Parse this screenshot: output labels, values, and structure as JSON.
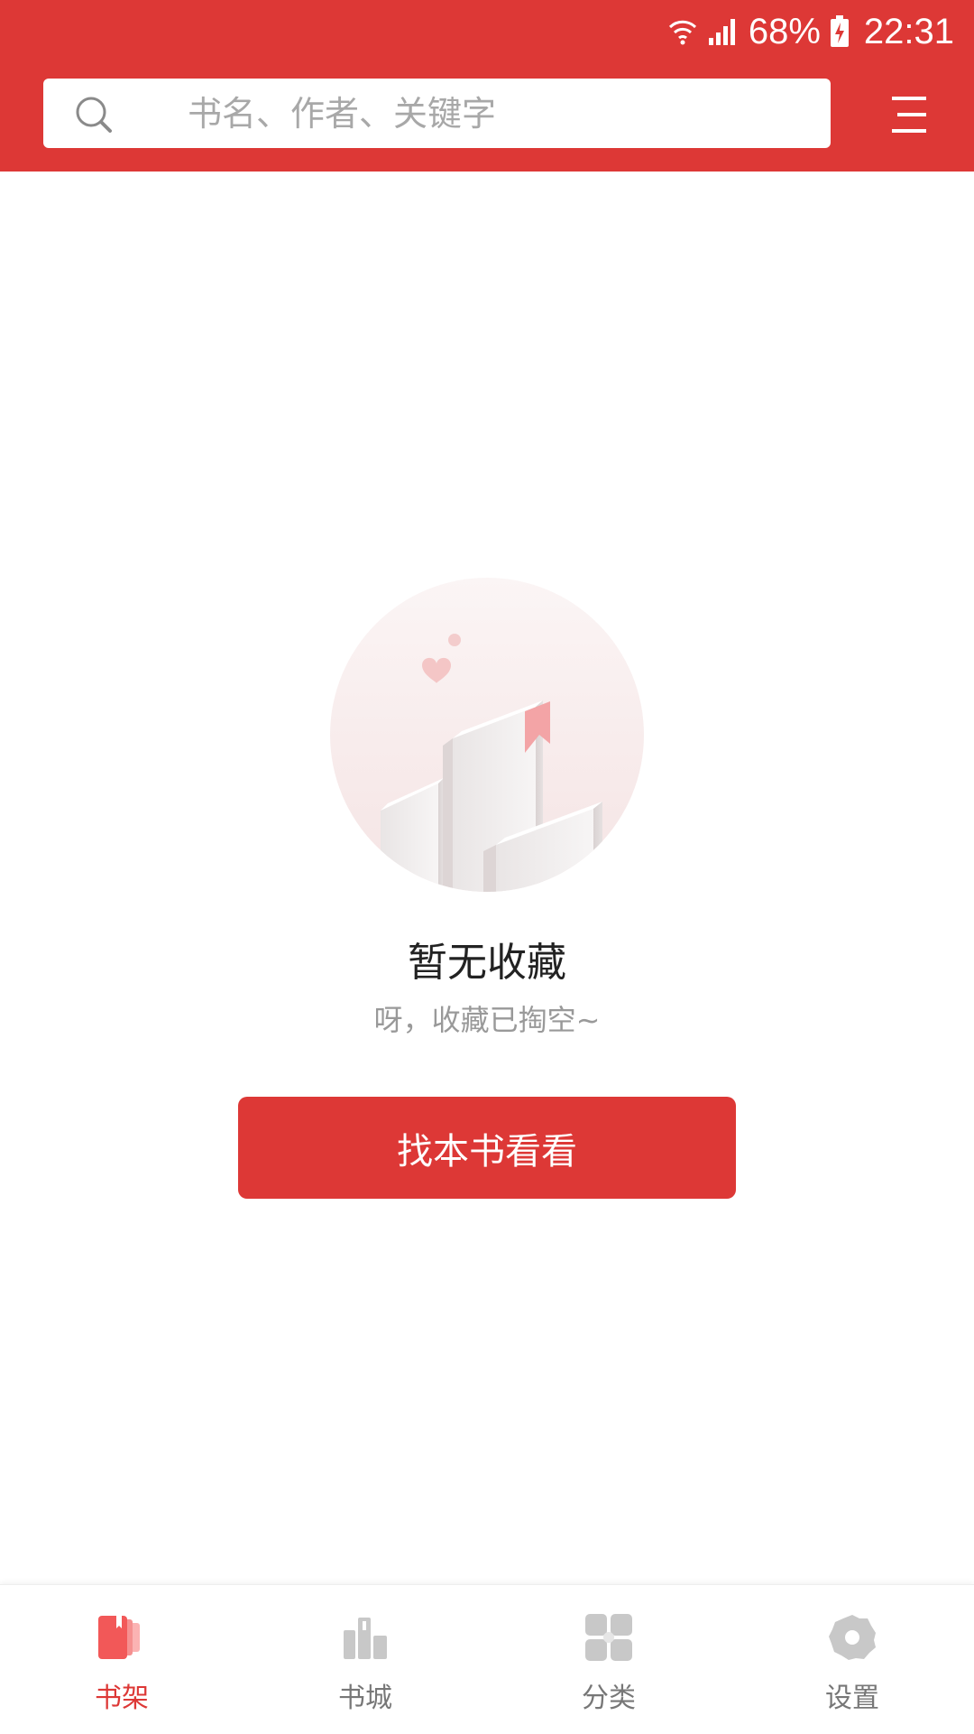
{
  "status_bar": {
    "wifi_icon": "wifi-icon",
    "signal_icon": "signal-icon",
    "battery_icon": "battery-charging-icon",
    "battery": "68%",
    "time": "22:31"
  },
  "header": {
    "search_placeholder": "书名、作者、关键字",
    "search_icon": "search-icon",
    "menu_icon": "menu-icon"
  },
  "empty_state": {
    "illustration": "empty-bookshelf-illustration",
    "title": "暂无收藏",
    "subtitle": "呀，收藏已掏空~",
    "button_label": "找本书看看"
  },
  "bottom_nav": {
    "items": [
      {
        "label": "书架",
        "icon": "bookshelf-icon",
        "active": true
      },
      {
        "label": "书城",
        "icon": "bookstore-icon",
        "active": false
      },
      {
        "label": "分类",
        "icon": "category-icon",
        "active": false
      },
      {
        "label": "设置",
        "icon": "settings-icon",
        "active": false
      }
    ]
  },
  "colors": {
    "primary": "#dd3836",
    "inactive": "#777777",
    "inactive_icon": "#c8c8c8"
  }
}
